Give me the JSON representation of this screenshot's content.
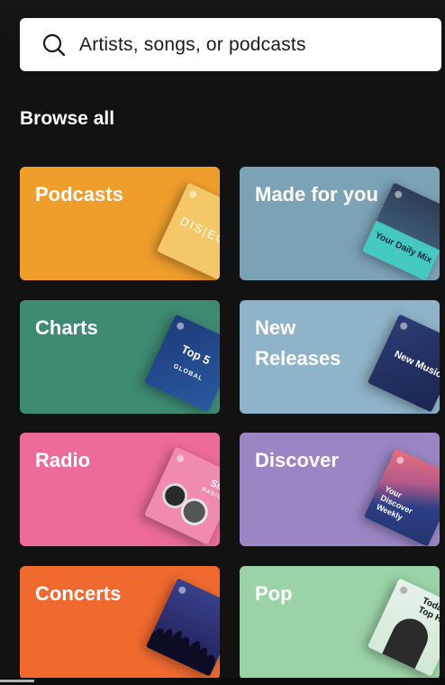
{
  "search": {
    "placeholder": "Artists, songs, or podcasts",
    "icon": "search-icon"
  },
  "browse": {
    "heading": "Browse all",
    "tiles": [
      {
        "label": "Podcasts",
        "color": "#ef9e2c",
        "art_color": "#f4c768",
        "art_text": "DIS|ECT"
      },
      {
        "label": "Made for you",
        "color": "#7ca2b6",
        "art_color": "#3b5874",
        "art_text": "Your Daily Mix"
      },
      {
        "label": "Charts",
        "color": "#3e8a73",
        "art_color": "#1f3f78",
        "art_text": "Top 5",
        "art_sub": "GLOBAL"
      },
      {
        "label": "New\nReleases",
        "color": "#8fb3c8",
        "art_color": "#2a3d74",
        "art_text": "New Music"
      },
      {
        "label": "Radio",
        "color": "#ec6b9a",
        "art_color": "#f08ab0",
        "art_text": "Sia",
        "art_sub": "RADIO"
      },
      {
        "label": "Discover",
        "color": "#9a86c4",
        "art_color": "#3a4a8a",
        "art_text": "Your Discover Weekly"
      },
      {
        "label": "Concerts",
        "color": "#f06a30",
        "art_color": "#2a2d6e",
        "art_text": ""
      },
      {
        "label": "Pop",
        "color": "#9bd3a6",
        "art_color": "#cfe8d4",
        "art_text": "Today's Top Hits"
      }
    ]
  }
}
